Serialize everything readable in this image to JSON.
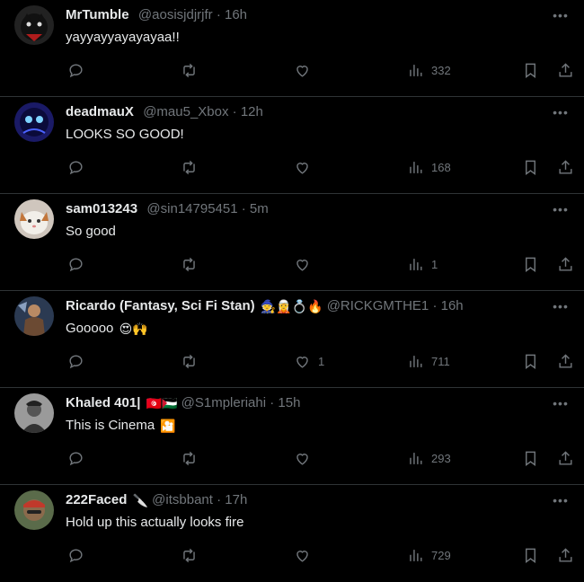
{
  "icons": {
    "reply": "reply-icon",
    "retweet": "retweet-icon",
    "like": "heart-icon",
    "views": "analytics-icon",
    "bookmark": "bookmark-icon",
    "share": "share-icon",
    "more": "more-icon"
  },
  "colors": {
    "background": "#000000",
    "text": "#e7e9ea",
    "muted": "#71767b",
    "divider": "#2f3336"
  },
  "tweets": [
    {
      "name": "MrTumble",
      "emojis": "",
      "handle": "@aosisjdjrjfr",
      "time": "16h",
      "text": "yayyayyayayayaa!!",
      "text_emoji": "",
      "likes": "",
      "views": "332"
    },
    {
      "name": "deadmauX",
      "emojis": "",
      "handle": "@mau5_Xbox",
      "time": "12h",
      "text": "LOOKS SO GOOD!",
      "text_emoji": "",
      "likes": "",
      "views": "168"
    },
    {
      "name": "sam013243",
      "emojis": "",
      "handle": "@sin14795451",
      "time": "5m",
      "text": "So good",
      "text_emoji": "",
      "likes": "",
      "views": "1"
    },
    {
      "name": "Ricardo (Fantasy, Sci Fi Stan)",
      "emojis": "🧙🧝💍🔥",
      "handle": "@RICKGMTHE1",
      "time": "16h",
      "text": "Gooooo",
      "text_emoji": "😍🙌",
      "likes": "1",
      "views": "711"
    },
    {
      "name": "Khaled 401|",
      "emojis": "🇹🇳🇵🇸",
      "handle": "@S1mpleriahi",
      "time": "15h",
      "text": "This is Cinema",
      "text_emoji": "🎦",
      "likes": "",
      "views": "293"
    },
    {
      "name": "222Faced",
      "emojis": "🔪",
      "handle": "@itsbbant",
      "time": "17h",
      "text": "Hold up this actually looks fire",
      "text_emoji": "",
      "likes": "",
      "views": "729"
    }
  ]
}
